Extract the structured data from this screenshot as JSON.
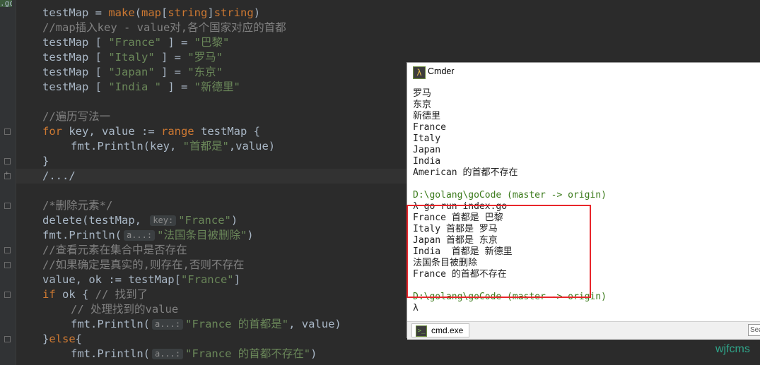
{
  "editor": {
    "tab_label": ".go",
    "lines": [
      {
        "parts": [
          [
            "",
            "testMap = "
          ],
          [
            "fn",
            "make"
          ],
          [
            "",
            "("
          ],
          [
            "kw",
            "map"
          ],
          [
            "",
            "["
          ],
          [
            "kw",
            "string"
          ],
          [
            "",
            "]"
          ],
          [
            "kw",
            "string"
          ],
          [
            "",
            ")"
          ]
        ]
      },
      {
        "parts": [
          [
            "cm",
            "//map插入key - value对,各个国家对应的首都"
          ]
        ]
      },
      {
        "parts": [
          [
            "",
            "testMap [ "
          ],
          [
            "str",
            "\"France\""
          ],
          [
            "",
            " ] = "
          ],
          [
            "str",
            "\"巴黎\""
          ]
        ]
      },
      {
        "parts": [
          [
            "",
            "testMap [ "
          ],
          [
            "str",
            "\"Italy\""
          ],
          [
            "",
            " ] = "
          ],
          [
            "str",
            "\"罗马\""
          ]
        ]
      },
      {
        "parts": [
          [
            "",
            "testMap [ "
          ],
          [
            "str",
            "\"Japan\""
          ],
          [
            "",
            " ] = "
          ],
          [
            "str",
            "\"东京\""
          ]
        ]
      },
      {
        "parts": [
          [
            "",
            "testMap [ "
          ],
          [
            "str",
            "\"India \""
          ],
          [
            "",
            " ] = "
          ],
          [
            "str",
            "\"新德里\""
          ]
        ]
      },
      {
        "parts": []
      },
      {
        "parts": [
          [
            "cm",
            "//遍历写法一"
          ]
        ]
      },
      {
        "parts": [
          [
            "kw",
            "for"
          ],
          [
            "",
            " key, value := "
          ],
          [
            "kw",
            "range"
          ],
          [
            "",
            " testMap {"
          ]
        ]
      },
      {
        "indent": 1,
        "parts": [
          [
            "",
            "fmt.Println(key, "
          ],
          [
            "str",
            "\"首都是\""
          ],
          [
            "",
            ",value)"
          ]
        ]
      },
      {
        "parts": [
          [
            "",
            "}"
          ]
        ]
      },
      {
        "parts": [
          [
            "",
            "/.../"
          ]
        ]
      },
      {
        "parts": []
      },
      {
        "parts": [
          [
            "cm",
            "/*删除元素*/"
          ]
        ]
      },
      {
        "parts": [
          [
            "",
            "delete(testMap, "
          ],
          [
            "hint",
            "key:"
          ],
          [
            "str",
            "\"France\""
          ],
          [
            "",
            ")"
          ]
        ]
      },
      {
        "parts": [
          [
            "",
            "fmt.Println("
          ],
          [
            "hint",
            "a...:"
          ],
          [
            "str",
            "\"法国条目被删除\""
          ],
          [
            "",
            ")"
          ]
        ]
      },
      {
        "parts": [
          [
            "cm",
            "//查看元素在集合中是否存在"
          ]
        ]
      },
      {
        "parts": [
          [
            "cm",
            "//如果确定是真实的,则存在,否则不存在"
          ]
        ]
      },
      {
        "parts": [
          [
            "",
            "value, ok := testMap["
          ],
          [
            "str",
            "\"France\""
          ],
          [
            "",
            "]"
          ]
        ]
      },
      {
        "parts": [
          [
            "kw",
            "if"
          ],
          [
            "",
            " ok { "
          ],
          [
            "cm",
            "// 找到了"
          ]
        ]
      },
      {
        "indent": 1,
        "parts": [
          [
            "cm",
            "// 处理找到的value"
          ]
        ]
      },
      {
        "indent": 1,
        "parts": [
          [
            "",
            "fmt.Println("
          ],
          [
            "hint",
            "a...:"
          ],
          [
            "str",
            "\"France 的首都是\""
          ],
          [
            "",
            ", value)"
          ]
        ]
      },
      {
        "parts": [
          [
            "",
            "}"
          ],
          [
            "kw",
            "else"
          ],
          [
            "",
            "{"
          ]
        ]
      },
      {
        "indent": 1,
        "parts": [
          [
            "",
            "fmt.Println("
          ],
          [
            "hint",
            "a...:"
          ],
          [
            "str",
            "\"France 的首都不存在\""
          ],
          [
            "",
            ")"
          ]
        ]
      }
    ]
  },
  "cmder": {
    "title": "Cmder",
    "lines": [
      {
        "text": "罗马",
        "kind": "out"
      },
      {
        "text": "东京",
        "kind": "out"
      },
      {
        "text": "新德里",
        "kind": "out"
      },
      {
        "text": "France",
        "kind": "out"
      },
      {
        "text": "Italy",
        "kind": "out"
      },
      {
        "text": "Japan",
        "kind": "out"
      },
      {
        "text": "India",
        "kind": "out"
      },
      {
        "text": "American 的首都不存在",
        "kind": "out"
      },
      {
        "text": "",
        "kind": "out"
      },
      {
        "text": "D:\\golang\\goCode (master -> origin)",
        "kind": "path"
      },
      {
        "text": "λ go run index.go",
        "kind": "out"
      },
      {
        "text": "France 首都是 巴黎",
        "kind": "out"
      },
      {
        "text": "Italy 首都是 罗马",
        "kind": "out"
      },
      {
        "text": "Japan 首都是 东京",
        "kind": "out"
      },
      {
        "text": "India  首都是 新德里",
        "kind": "out"
      },
      {
        "text": "法国条目被删除",
        "kind": "out"
      },
      {
        "text": "France 的首都不存在",
        "kind": "out"
      },
      {
        "text": "",
        "kind": "out"
      },
      {
        "text": "D:\\golang\\goCode (master -> origin)",
        "kind": "path"
      },
      {
        "text": "λ",
        "kind": "out"
      }
    ],
    "task_tab_label": "cmd.exe",
    "search_label": "Sea"
  },
  "watermark": "wjfcms"
}
